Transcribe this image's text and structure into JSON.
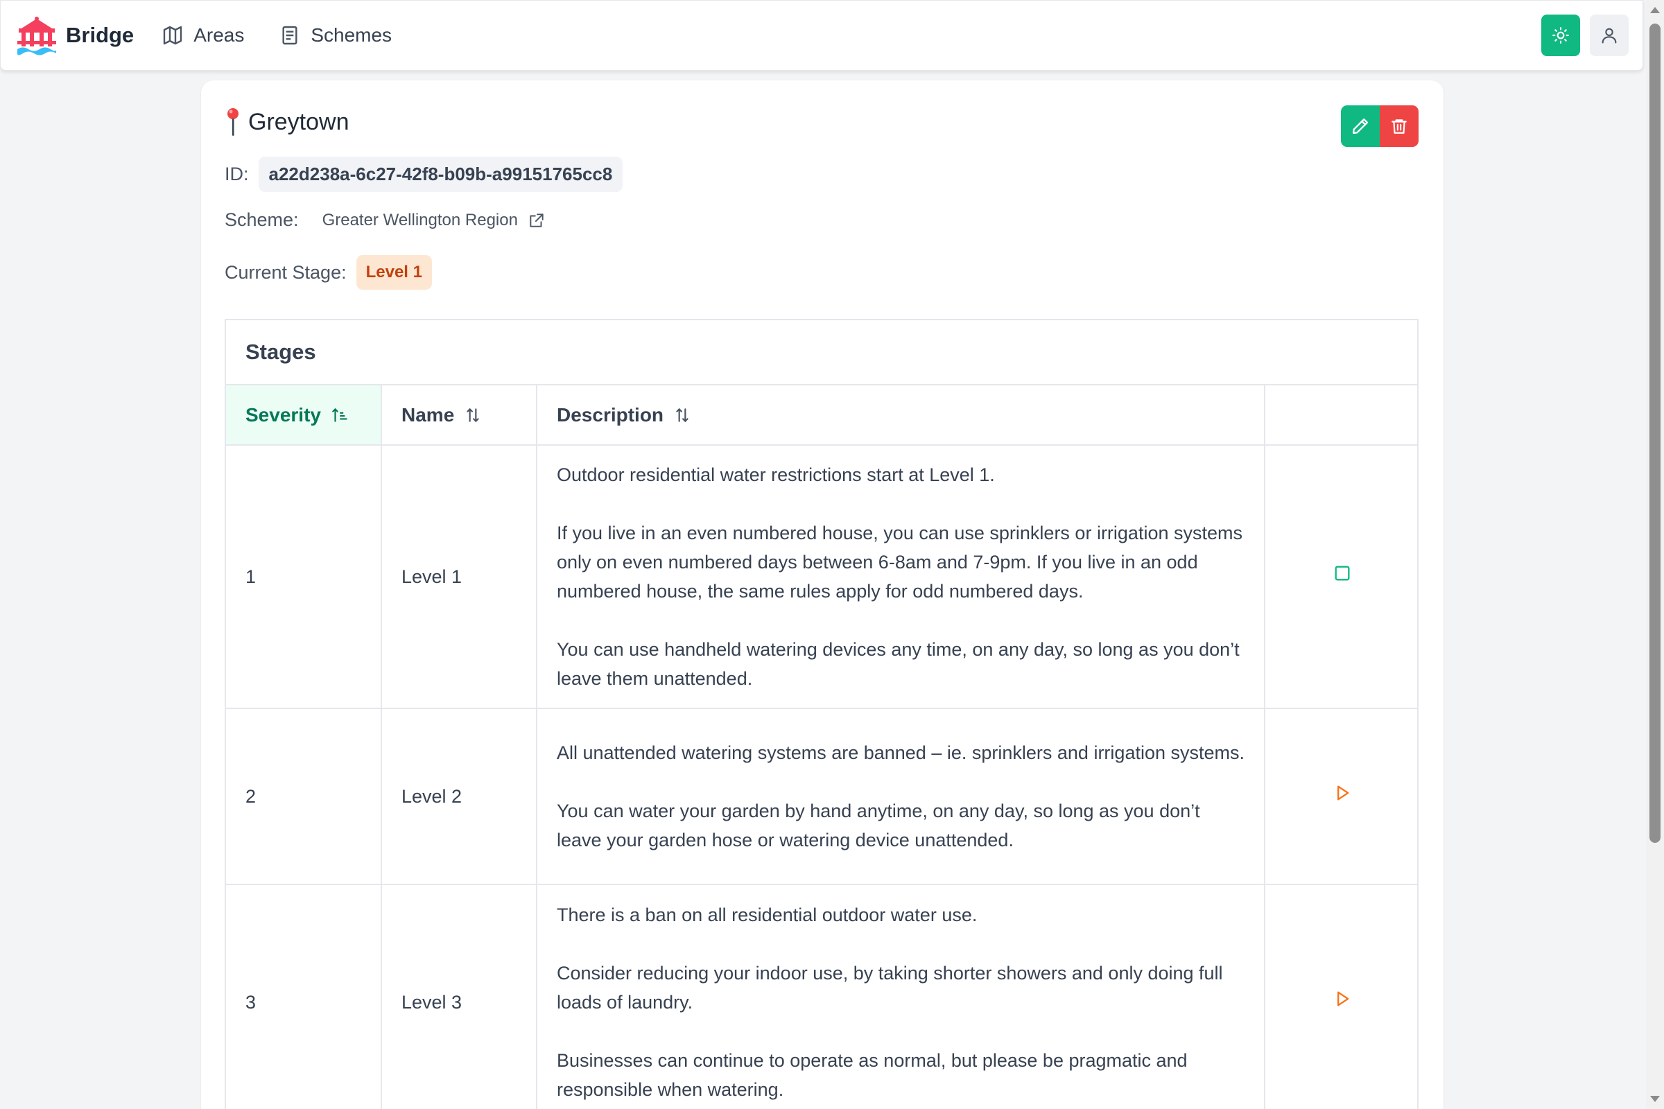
{
  "nav": {
    "brand": "Bridge",
    "links": [
      {
        "label": "Areas",
        "icon": "map-icon"
      },
      {
        "label": "Schemes",
        "icon": "document-list-icon"
      }
    ],
    "theme_icon": "sun-icon",
    "user_icon": "user-icon",
    "accent_color": "#10b981"
  },
  "area": {
    "name": "Greytown",
    "id_label": "ID:",
    "id_value": "a22d238a-6c27-42f8-b09b-a99151765cc8",
    "scheme_label": "Scheme:",
    "scheme_value": "Greater Wellington Region",
    "stage_label": "Current Stage:",
    "stage_value": "Level 1"
  },
  "actions": {
    "edit_icon": "pencil-icon",
    "delete_icon": "trash-icon",
    "delete_color": "#ef4444"
  },
  "stages": {
    "title": "Stages",
    "columns": [
      "Severity",
      "Name",
      "Description",
      ""
    ],
    "rows": [
      {
        "severity": "1",
        "name": "Level 1",
        "description": [
          "Outdoor residential water restrictions start at Level 1.",
          "If you live in an even numbered house, you can use sprinklers or irrigation systems only on even numbered days between 6-8am and 7-9pm. If you live in an odd numbered house, the same rules apply for odd numbered days.",
          "You can use handheld watering devices any time, on any day, so long as you don’t leave them unattended."
        ],
        "action_icon": "stop-square-icon"
      },
      {
        "severity": "2",
        "name": "Level 2",
        "description": [
          "All unattended watering systems are banned – ie. sprinklers and irrigation systems.",
          "You can water your garden by hand anytime, on any day, so long as you don’t leave your garden hose or watering device unattended."
        ],
        "action_icon": "play-icon"
      },
      {
        "severity": "3",
        "name": "Level 3",
        "description": [
          "There is a ban on all residential outdoor water use.",
          "Consider reducing your indoor use, by taking shorter showers and only doing full loads of laundry.",
          "Businesses can continue to operate as normal, but please be pragmatic and responsible when watering."
        ],
        "action_icon": "play-icon"
      }
    ]
  }
}
